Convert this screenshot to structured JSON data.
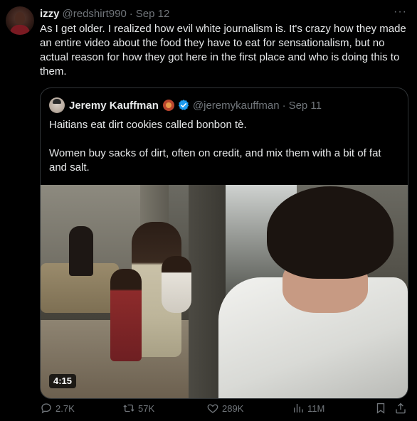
{
  "tweet": {
    "author": {
      "display_name": "izzy",
      "handle": "@redshirt990",
      "date": "Sep 12"
    },
    "separator": "·",
    "more_label": "···",
    "text": "As I get older. I realized how evil white journalism is. It's crazy how they made an entire video about the food they have to eat for sensationalism, but no actual reason for how they got here in the first place and who is doing this to them."
  },
  "quote": {
    "author": {
      "display_name": "Jeremy Kauffman",
      "handle": "@jeremykauffman",
      "date": "Sep 11"
    },
    "separator": "·",
    "paragraphs": [
      "Haitians eat dirt cookies called bonbon tè.",
      "Women buy sacks of dirt, often on credit, and mix them with a bit of fat and salt."
    ],
    "video": {
      "duration": "4:15"
    }
  },
  "actions": {
    "reply": {
      "icon": "reply-icon",
      "count": "2.7K"
    },
    "retweet": {
      "icon": "retweet-icon",
      "count": "57K"
    },
    "like": {
      "icon": "heart-icon",
      "count": "289K"
    },
    "views": {
      "icon": "views-icon",
      "count": "11M"
    },
    "bookmark": {
      "icon": "bookmark-icon"
    },
    "share": {
      "icon": "share-icon"
    }
  },
  "colors": {
    "background": "#000000",
    "text": "#e7e9ea",
    "muted": "#71767b",
    "border": "#2f3336",
    "verified": "#1d9bf0"
  }
}
